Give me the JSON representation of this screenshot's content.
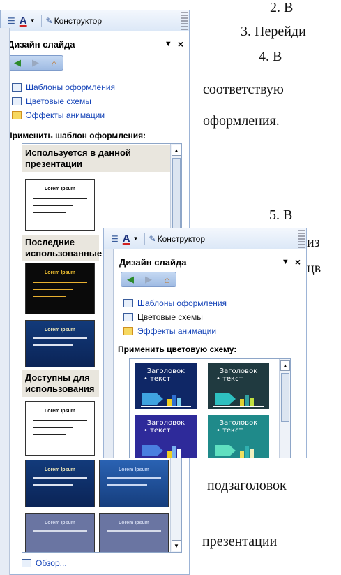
{
  "document": {
    "lines": [
      {
        "text": "2.        В"
      },
      {
        "text": "3. Перейди"
      },
      {
        "text": "4.        В"
      },
      {
        "text": "соответствую"
      },
      {
        "text": "оформления."
      },
      {
        "text": "5.        В"
      },
      {
        "text": "из"
      },
      {
        "text": "цв"
      },
      {
        "text": "подзаголовок"
      },
      {
        "text": "презентации"
      }
    ]
  },
  "pane1": {
    "toolbar": {
      "constructor_label": "Конструктор"
    },
    "header": {
      "title": "Дизайн слайда"
    },
    "links": [
      {
        "label": "Шаблоны оформления"
      },
      {
        "label": "Цветовые схемы"
      },
      {
        "label": "Эффекты анимации"
      }
    ],
    "apply_label": "Применить шаблон оформления:",
    "groups": [
      {
        "label": "Используется в данной презентации"
      },
      {
        "label": "Последние использованные"
      },
      {
        "label": "Доступны для использования"
      }
    ],
    "thumb_titles": [
      "Lorem Ipsum",
      "Lorem Ipsum",
      "Lorem Ipsum",
      "Lorem Ipsum",
      "Lorem Ipsum",
      "Lorem Ipsum"
    ],
    "browse_label": "Обзор..."
  },
  "pane2": {
    "toolbar": {
      "constructor_label": "Конструктор"
    },
    "header": {
      "title": "Дизайн слайда"
    },
    "links": [
      {
        "label": "Шаблоны оформления"
      },
      {
        "label": "Цветовые схемы"
      },
      {
        "label": "Эффекты анимации"
      }
    ],
    "apply_label": "Применить цветовую схему:",
    "schemes": [
      {
        "heading": "Заголовок",
        "body": "• текст",
        "bg": "#0f2766",
        "arrow": "#3fa3e0",
        "bars": [
          "#f0d020",
          "#2f6fd0",
          "#7ad0f0"
        ]
      },
      {
        "heading": "Заголовок",
        "body": "• текст",
        "bg": "#203a40",
        "arrow": "#2ec0c0",
        "bars": [
          "#e0d030",
          "#30a0a0",
          "#c0e040"
        ]
      },
      {
        "heading": "Заголовок",
        "body": "• текст",
        "bg": "#2e2a9a",
        "arrow": "#4a7fe0",
        "bars": [
          "#f0d020",
          "#7ab0f0",
          "#ffffff"
        ]
      },
      {
        "heading": "Заголовок",
        "body": "• текст",
        "bg": "#1f8a8a",
        "arrow": "#60e0c0",
        "bars": [
          "#f0e060",
          "#30b0b0",
          "#f0f0c0"
        ]
      }
    ]
  }
}
